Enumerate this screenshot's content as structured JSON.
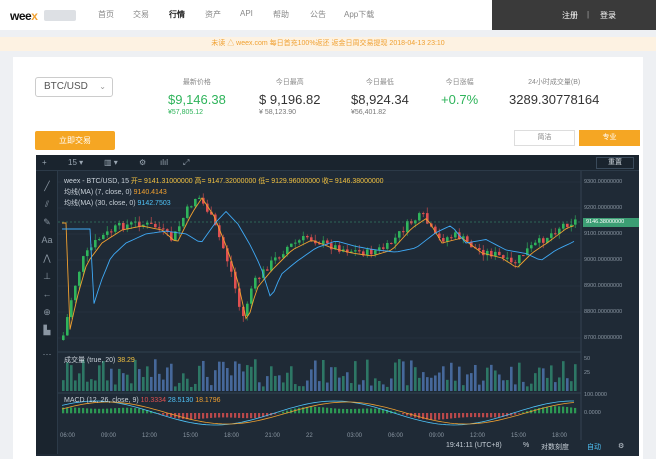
{
  "nav": {
    "logo": "weex",
    "items": [
      "首页",
      "交易",
      "行情",
      "资产",
      "API",
      "帮助",
      "公告",
      "App下载"
    ],
    "active_index": 2,
    "register": "注册",
    "separator": "|",
    "login": "登录"
  },
  "notice": {
    "text": "未读 △  weex.com 每日首充100%返还 返金日周交易提现  2018-04-13 23:10"
  },
  "market": {
    "pair": "BTC/USD",
    "stats": [
      {
        "label": "最新价格",
        "value": "$9,146.38",
        "sub": "¥57,805.12",
        "color": "green"
      },
      {
        "label": "今日最高",
        "value": "$ 9,196.82",
        "sub": "¥ 58,123.90",
        "color": ""
      },
      {
        "label": "今日最低",
        "value": "$8,924.34",
        "sub": "¥56,401.82",
        "color": ""
      },
      {
        "label": "今日涨幅",
        "value": "+0.7%",
        "sub": "",
        "color": "green"
      },
      {
        "label": "24小时成交量(B)",
        "value": "3289.30778164",
        "sub": "",
        "color": ""
      }
    ],
    "trade_button": "立即交易",
    "mode_simple": "简洁",
    "mode_pro": "专业"
  },
  "chart_toolbar": {
    "interval": "15",
    "fullscreen": "重置"
  },
  "chart_legend": {
    "line1_prefix": "weex - BTC/USD, 15",
    "ohlc": "开= 9141.31000000 高= 9147.32000000 低= 9129.96000000 收= 9146.38000000",
    "ma7_label": "均线(MA) (7, close, 0)",
    "ma7_value": "9140.4143",
    "ma30_label": "均线(MA) (30, close, 0)",
    "ma30_value": "9142.7503",
    "volume_label": "成交量 (true, 20)",
    "volume_value": "38.29",
    "macd_label": "MACD (12, 26, close, 9)",
    "macd_v1": "10.3334",
    "macd_v2": "28.5130",
    "macd_v3": "18.1796"
  },
  "price_axis": [
    "9300.00000000",
    "9200.00000000",
    "9100.00000000",
    "9000.00000000",
    "8900.00000000",
    "8800.00000000",
    "8700.00000000"
  ],
  "last_price_tag": "9146.38000000",
  "volume_axis": [
    "50",
    "25"
  ],
  "macd_axis": [
    "100.0000",
    "0.0000"
  ],
  "time_axis": [
    "06:00",
    "09:00",
    "12:00",
    "15:00",
    "18:00",
    "21:00",
    "22",
    "03:00",
    "06:00",
    "09:00",
    "12:00",
    "15:00",
    "18:00"
  ],
  "bottom_bar": {
    "clock": "19:41:11 (UTC+8)",
    "percent": "%",
    "log": "对数刻度",
    "auto": "自动"
  },
  "colors": {
    "accent": "#f5a623",
    "up": "#2fb45b",
    "down": "#e05050",
    "chart_bg": "#1f2a36"
  }
}
